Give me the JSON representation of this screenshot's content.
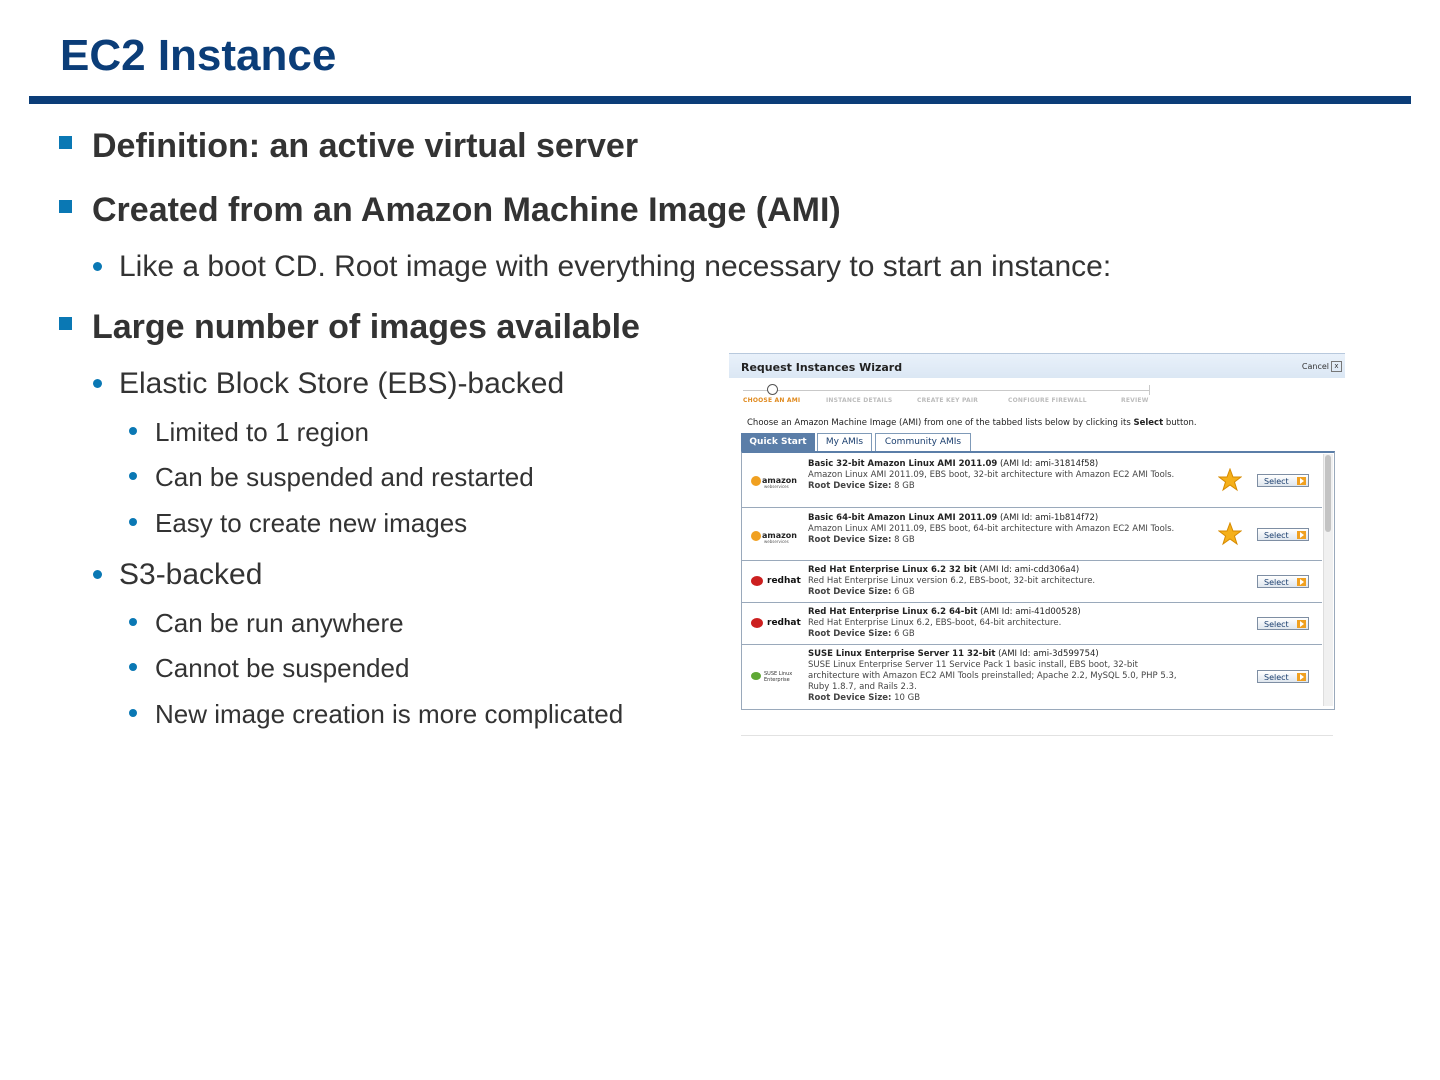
{
  "slide": {
    "title": "EC2 Instance"
  },
  "bullets": {
    "b1": "Definition: an active virtual server",
    "b2": "Created from an Amazon Machine Image (AMI)",
    "b2_1": "Like a boot CD. Root image with everything necessary to start an instance:",
    "b3": "Large number of images available",
    "b3_1": "Elastic Block Store (EBS)-backed",
    "b3_1_1": "Limited to 1 region",
    "b3_1_2": "Can be suspended and restarted",
    "b3_1_3": "Easy to create new images",
    "b3_2": "S3-backed",
    "b3_2_1": "Can be run anywhere",
    "b3_2_2": "Cannot be suspended",
    "b3_2_3": "New image creation is more complicated"
  },
  "wizard": {
    "title": "Request Instances Wizard",
    "cancel_label": "Cancel",
    "close_glyph": "x",
    "steps": [
      "CHOOSE AN AMI",
      "INSTANCE DETAILS",
      "CREATE KEY PAIR",
      "CONFIGURE FIREWALL",
      "REVIEW"
    ],
    "instruction_pre": "Choose an Amazon Machine Image (AMI) from one of the tabbed lists below by clicking its ",
    "instruction_bold": "Select",
    "instruction_post": " button.",
    "tabs": [
      "Quick Start",
      "My AMIs",
      "Community AMIs"
    ],
    "select_label": "Select",
    "root_label": "Root Device Size:",
    "logos": {
      "aws_text": "amazon",
      "aws_sub": "webservices",
      "redhat_text": "redhat",
      "suse_line1": "SUSE Linux",
      "suse_line2": "Enterprise"
    },
    "amis": [
      {
        "name": "Basic 32-bit Amazon Linux AMI 2011.09",
        "ami_id": "(AMI Id: ami-31814f58)",
        "desc": "Amazon Linux AMI 2011.09, EBS boot, 32-bit architecture with Amazon EC2 AMI Tools.",
        "root_size": "8 GB",
        "logo": "aws",
        "starred": true
      },
      {
        "name": "Basic 64-bit Amazon Linux AMI 2011.09",
        "ami_id": "(AMI Id: ami-1b814f72)",
        "desc": "Amazon Linux AMI 2011.09, EBS boot, 64-bit architecture with Amazon EC2 AMI Tools.",
        "root_size": "8 GB",
        "logo": "aws",
        "starred": true
      },
      {
        "name": "Red Hat Enterprise Linux 6.2 32 bit",
        "ami_id": "(AMI Id: ami-cdd306a4)",
        "desc": "Red Hat Enterprise Linux version 6.2, EBS-boot, 32-bit architecture.",
        "root_size": "6 GB",
        "logo": "redhat",
        "starred": false
      },
      {
        "name": "Red Hat Enterprise Linux 6.2 64-bit",
        "ami_id": "(AMI Id: ami-41d00528)",
        "desc": "Red Hat Enterprise Linux 6.2, EBS-boot, 64-bit architecture.",
        "root_size": "6 GB",
        "logo": "redhat",
        "starred": false
      },
      {
        "name": "SUSE Linux Enterprise Server 11 32-bit",
        "ami_id": "(AMI Id: ami-3d599754)",
        "desc": "SUSE Linux Enterprise Server 11 Service Pack 1 basic install, EBS boot, 32-bit architecture with Amazon EC2 AMI Tools preinstalled; Apache 2.2, MySQL 5.0, PHP 5.3, Ruby 1.8.7, and Rails 2.3.",
        "root_size": "10 GB",
        "logo": "suse",
        "starred": false
      }
    ]
  },
  "colors": {
    "title": "#0b3d78",
    "bullet_marker": "#0a78b4",
    "body_text": "#333333",
    "active_step": "#e08a1e"
  }
}
